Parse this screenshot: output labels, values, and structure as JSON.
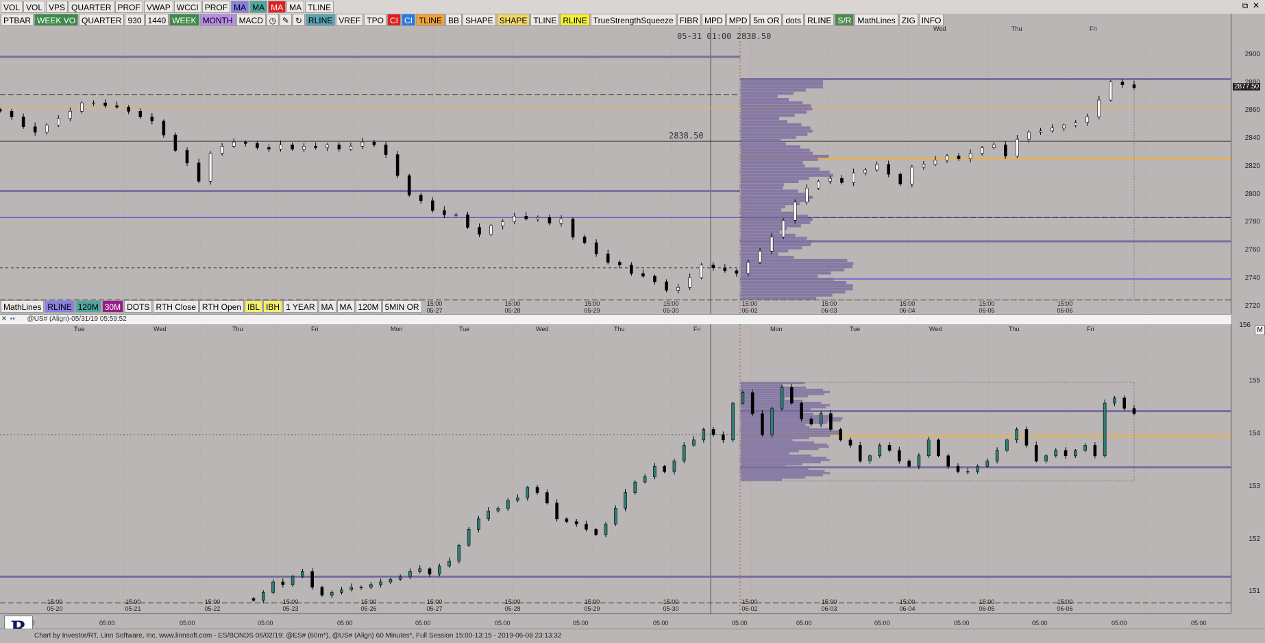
{
  "toolbar_top": [
    "VOL",
    "VOL",
    "VPS",
    "QUARTER",
    "PROF",
    "VWAP",
    "WCCI",
    "PROF",
    "MA",
    "MA",
    "MA",
    "MA",
    "TLINE"
  ],
  "toolbar_top_colors": [
    "#ece9e6",
    "#ece9e6",
    "#ece9e6",
    "#ece9e6",
    "#ece9e6",
    "#ece9e6",
    "#ece9e6",
    "#ece9e6",
    "#8a7fe6",
    "#4fa79d",
    "#e02020",
    "#ece9e6",
    "#ece9e6"
  ],
  "toolbar_top_right": [
    "⧉",
    "✕"
  ],
  "toolbar_second": [
    "PTBAR",
    "WEEK VO",
    "QUARTER",
    "930",
    "1440",
    "WEEK",
    "MONTH",
    "MACD",
    "clock-icon",
    "pen-icon",
    "rotate-icon",
    "RLINE",
    "VREF",
    "TPO",
    "CI",
    "CI",
    "TLINE",
    "BB",
    "SHAPE",
    "SHAPE",
    "TLINE",
    "RLINE",
    "TrueStrengthSqueeze",
    "FIBR",
    "MPD",
    "MPD",
    "5m OR",
    "dots",
    "RLINE",
    "S/R",
    "MathLines",
    "ZIG",
    "INFO"
  ],
  "toolbar_second_colors": [
    "#ece9e6",
    "#3e8a4a",
    "#ece9e6",
    "#ece9e6",
    "#ece9e6",
    "#3e8a4a",
    "#b88ee8",
    "#ece9e6",
    "#ece9e6",
    "#ece9e6",
    "#ece9e6",
    "#5aa4b0",
    "#ece9e6",
    "#ece9e6",
    "#e02020",
    "#2a7be0",
    "#f2a23a",
    "#ece9e6",
    "#ece9e6",
    "#f2d86a",
    "#ece9e6",
    "#f5f03a",
    "#ece9e6",
    "#ece9e6",
    "#ece9e6",
    "#ece9e6",
    "#ece9e6",
    "#ece9e6",
    "#ece9e6",
    "#4e8a4e",
    "#ece9e6",
    "#ece9e6",
    "#ece9e6"
  ],
  "toolbar_lower": [
    "MathLines",
    "RLINE",
    "120M",
    "30M",
    "DOTS",
    "RTH Close",
    "RTH Open",
    "IBL",
    "IBH",
    "1 YEAR",
    "MA",
    "MA",
    "120M",
    "5MIN OR"
  ],
  "toolbar_lower_colors": [
    "#ece9e6",
    "#8a7fe6",
    "#4fa79d",
    "#9a1a8a",
    "#ece9e6",
    "#ece9e6",
    "#ece9e6",
    "#f5f06a",
    "#f5f06a",
    "#ece9e6",
    "#ece9e6",
    "#ece9e6",
    "#ece9e6",
    "#ece9e6"
  ],
  "top_pane": {
    "crosshair_label": "05-31 01:00",
    "crosshair_price": "2838.50",
    "hline_label": "2838.50",
    "current_price": "2877.50",
    "price_ticks": [
      "2900",
      "2880",
      "2860",
      "2840",
      "2820",
      "2800",
      "2780",
      "2760",
      "2740",
      "2720"
    ],
    "day_labels": [
      "Wed",
      "Thu",
      "Fri"
    ],
    "time_labels": [
      [
        "15:00",
        "05-27"
      ],
      [
        "15:00",
        "05-28"
      ],
      [
        "15:00",
        "05-29"
      ],
      [
        "15:00",
        "05-30"
      ],
      [
        "15:00",
        "06-02"
      ],
      [
        "15:00",
        "06-03"
      ],
      [
        "15:00",
        "06-04"
      ],
      [
        "15:00",
        "06-05"
      ],
      [
        "15:00",
        "06-06"
      ]
    ]
  },
  "separator": {
    "symbol_label": "@US# (Align)-05/31/19 05:59:52"
  },
  "bottom_pane": {
    "day_labels": [
      "Tue",
      "Wed",
      "Thu",
      "Fri",
      "Mon",
      "Tue",
      "Wed",
      "Thu",
      "Fri",
      "Mon",
      "Tue",
      "Wed",
      "Thu",
      "Fri"
    ],
    "price_ticks": [
      "155",
      "154",
      "153",
      "152",
      "151"
    ],
    "top_tick": "156",
    "scale_button": "M",
    "time_labels": [
      [
        "15:00",
        "05-20"
      ],
      [
        "15:00",
        "05-21"
      ],
      [
        "15:00",
        "05-22"
      ],
      [
        "15:00",
        "05-23"
      ],
      [
        "15:00",
        "05-26"
      ],
      [
        "15:00",
        "05-27"
      ],
      [
        "15:00",
        "05-28"
      ],
      [
        "15:00",
        "05-29"
      ],
      [
        "15:00",
        "05-30"
      ],
      [
        "15:00",
        "06-02"
      ],
      [
        "15:00",
        "06-03"
      ],
      [
        "15:00",
        "06-04"
      ],
      [
        "15:00",
        "06-05"
      ],
      [
        "15:00",
        "06-06"
      ]
    ],
    "hour_labels": [
      "05:00",
      "05:00",
      "05:00",
      "05:00",
      "05:00",
      "05:00",
      "05:00",
      "05:00",
      "05:00",
      "05:00",
      "05:00",
      "05:00",
      "05:00",
      "05:00",
      "05:00",
      "05:00"
    ]
  },
  "footer": {
    "logo": "R",
    "text": "Chart by Investor/RT, Linn Software, Inc. www.linnsoft.com - ES/BONDS 06/02/19: @ES# (60m*), @US# (Align) 60 Minutes*, Full Session 15:00-13:15 - 2019-06-08 23:13:32"
  },
  "chart_data": [
    {
      "type": "candlestick",
      "title": "@ES# 60 Minutes",
      "ylim": [
        2715,
        2920
      ],
      "hlines": [
        2838.5,
        2862.5,
        2883
      ],
      "colors": {
        "up": "#ffffff",
        "down": "#000000",
        "gold": "#f2b040",
        "purple": "#6a3fd8",
        "profile": "#7d6fa0"
      },
      "series": [
        {
          "name": "@ES#",
          "values": [
            2860,
            2856,
            2849,
            2845,
            2850,
            2855,
            2860,
            2866,
            2866,
            2864,
            2863,
            2860,
            2856,
            2853,
            2843,
            2832,
            2823,
            2810,
            2830,
            2835,
            2838,
            2837,
            2834,
            2833,
            2836,
            2833,
            2835,
            2834,
            2836,
            2833,
            2835,
            2838,
            2836,
            2829,
            2814,
            2800,
            2796,
            2789,
            2786,
            2786,
            2777,
            2772,
            2778,
            2781,
            2785,
            2783,
            2784,
            2780,
            2783,
            2770,
            2766,
            2758,
            2752,
            2750,
            2744,
            2742,
            2738,
            2732,
            2734,
            2741,
            2750,
            2748,
            2746,
            2744,
            2752,
            2760,
            2770,
            2782,
            2795,
            2805,
            2810,
            2812,
            2809,
            2816,
            2818,
            2822,
            2815,
            2808,
            2820,
            2822,
            2825,
            2828,
            2826,
            2830,
            2834,
            2836,
            2828,
            2840,
            2845,
            2846,
            2848,
            2850,
            2852,
            2856,
            2868,
            2881,
            2879,
            2877
          ]
        }
      ]
    },
    {
      "type": "candlestick",
      "title": "@US# (Align) 60 Minutes",
      "ylim": [
        150.6,
        156.1
      ],
      "hlines": [
        151.3,
        153.98,
        154.45,
        153.38
      ],
      "colors": {
        "up": "#2e7f7a",
        "down": "#000000",
        "gold": "#f2b040",
        "purple": "#6a3fd8",
        "profile": "#7d6fa0"
      },
      "series": [
        {
          "name": "@US#",
          "values": [
            150.85,
            151.0,
            151.2,
            151.15,
            151.3,
            151.4,
            151.1,
            150.95,
            151.0,
            151.05,
            151.1,
            151.1,
            151.15,
            151.2,
            151.25,
            151.3,
            151.4,
            151.45,
            151.35,
            151.5,
            151.6,
            151.9,
            152.2,
            152.4,
            152.55,
            152.6,
            152.75,
            152.8,
            153.0,
            152.9,
            152.7,
            152.4,
            152.35,
            152.3,
            152.2,
            152.1,
            152.3,
            152.6,
            152.9,
            153.1,
            153.2,
            153.4,
            153.3,
            153.5,
            153.8,
            153.9,
            154.1,
            154.0,
            153.9,
            154.6,
            154.8,
            154.4,
            154.0,
            154.5,
            154.9,
            154.6,
            154.3,
            154.2,
            154.4,
            154.1,
            153.9,
            153.8,
            153.5,
            153.6,
            153.8,
            153.7,
            153.5,
            153.4,
            153.6,
            153.9,
            153.6,
            153.4,
            153.3,
            153.3,
            153.4,
            153.5,
            153.7,
            153.9,
            154.1,
            153.8,
            153.5,
            153.6,
            153.7,
            153.6,
            153.7,
            153.8,
            153.6,
            154.6,
            154.7,
            154.5,
            154.4
          ]
        }
      ]
    }
  ]
}
